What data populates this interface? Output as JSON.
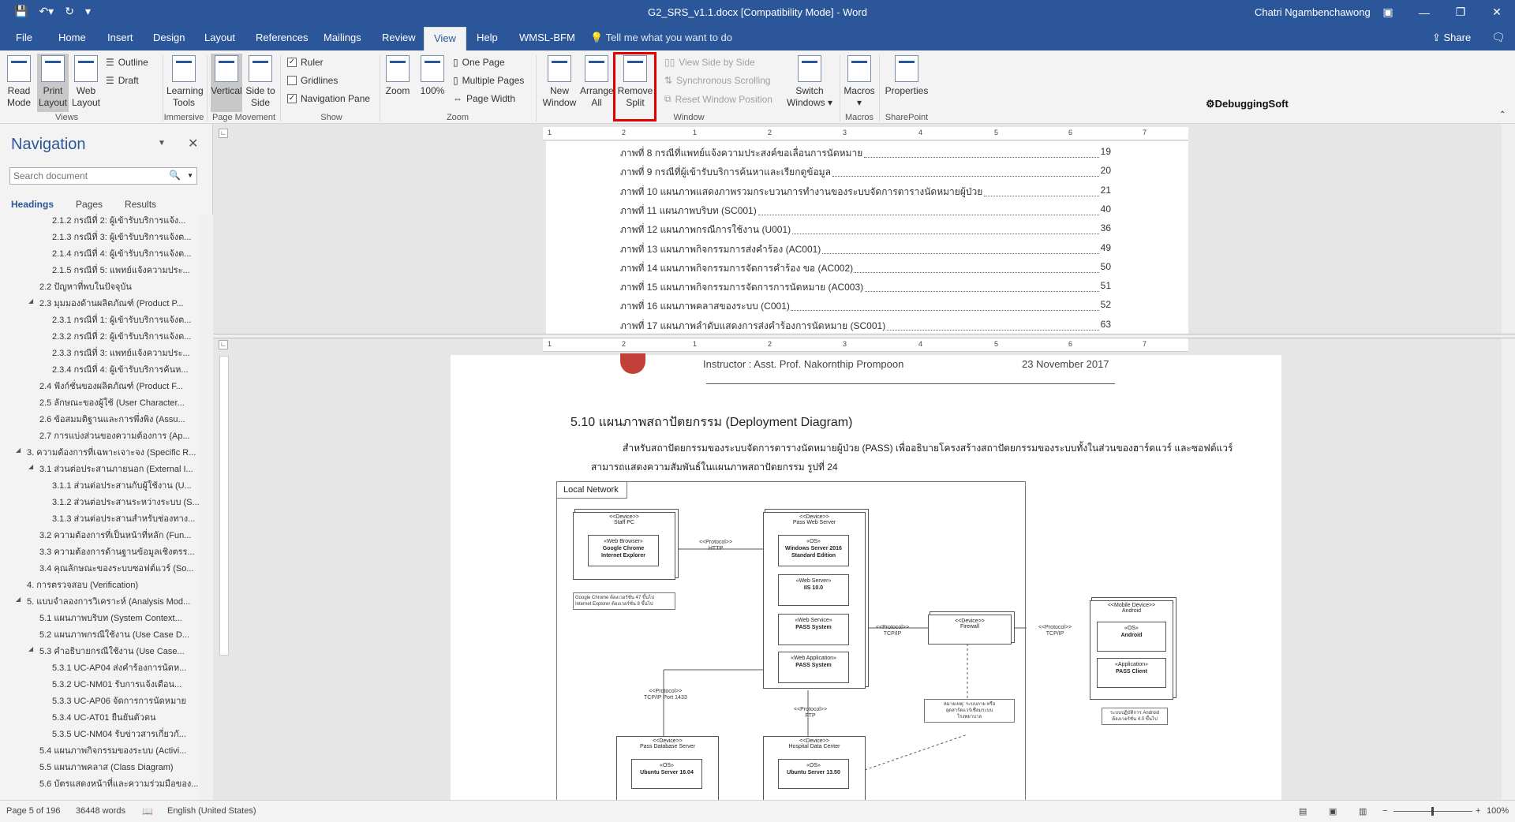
{
  "window": {
    "title": "G2_SRS_v1.1.docx [Compatibility Mode] - Word",
    "user": "Chatri Ngambenchawong"
  },
  "tabs": [
    "File",
    "Home",
    "Insert",
    "Design",
    "Layout",
    "References",
    "Mailings",
    "Review",
    "View",
    "Help",
    "WMSL-BFM"
  ],
  "active_tab": "View",
  "tell_me": "Tell me what you want to do",
  "share": "Share",
  "ribbon": {
    "views": {
      "read_mode": "Read Mode",
      "print_layout": "Print Layout",
      "web_layout": "Web Layout",
      "outline": "Outline",
      "draft": "Draft",
      "group": "Views"
    },
    "immersive": {
      "learning_tools": "Learning Tools",
      "group": "Immersive"
    },
    "page_movement": {
      "vertical": "Vertical",
      "side_to_side": "Side to Side",
      "group": "Page Movement"
    },
    "show": {
      "ruler": "Ruler",
      "gridlines": "Gridlines",
      "navigation_pane": "Navigation Pane",
      "group": "Show",
      "ruler_checked": true,
      "gridlines_checked": false,
      "navigation_checked": true
    },
    "zoom": {
      "zoom": "Zoom",
      "hundred": "100%",
      "one_page": "One Page",
      "multiple_pages": "Multiple Pages",
      "page_width": "Page Width",
      "group": "Zoom"
    },
    "window": {
      "new_window": "New Window",
      "arrange_all": "Arrange All",
      "remove_split": "Remove Split",
      "view_side_by_side": "View Side by Side",
      "synchronous_scrolling": "Synchronous Scrolling",
      "reset_window_position": "Reset Window Position",
      "switch_windows": "Switch Windows",
      "group": "Window"
    },
    "macros": {
      "macros": "Macros",
      "group": "Macros"
    },
    "sharepoint": {
      "properties": "Properties",
      "group": "SharePoint"
    }
  },
  "watermark_logo": "DebuggingSoft",
  "navigation": {
    "title": "Navigation",
    "search_placeholder": "Search document",
    "tabs": [
      "Headings",
      "Pages",
      "Results"
    ],
    "headings": [
      {
        "text": "2.1.2 กรณีที่ 2: ผู้เข้ารับบริการแจ้ง...",
        "level": 3
      },
      {
        "text": "2.1.3 กรณีที่ 3: ผู้เข้ารับบริการแจ้งต...",
        "level": 3
      },
      {
        "text": "2.1.4 กรณีที่ 4: ผู้เข้ารับบริการแจ้งต...",
        "level": 3
      },
      {
        "text": "2.1.5 กรณีที่ 5: แพทย์แจ้งความประ...",
        "level": 3
      },
      {
        "text": "2.2 ปัญหาที่พบในปัจจุบัน",
        "level": 2
      },
      {
        "text": "2.3 มุมมองด้านผลิตภัณฑ์ (Product P...",
        "level": 2,
        "expanded": true
      },
      {
        "text": "2.3.1 กรณีที่ 1: ผู้เข้ารับบริการแจ้งต...",
        "level": 3
      },
      {
        "text": "2.3.2 กรณีที่ 2: ผู้เข้ารับบริการแจ้งต...",
        "level": 3
      },
      {
        "text": "2.3.3 กรณีที่ 3: แพทย์แจ้งความประ...",
        "level": 3
      },
      {
        "text": "2.3.4 กรณีที่ 4: ผู้เข้ารับบริการค้นห...",
        "level": 3
      },
      {
        "text": "2.4 ฟังก์ชั่นของผลิตภัณฑ์ (Product F...",
        "level": 2
      },
      {
        "text": "2.5 ลักษณะของผู้ใช้ (User Character...",
        "level": 2
      },
      {
        "text": "2.6 ข้อสมมติฐานและการพึ่งพิง (Assu...",
        "level": 2
      },
      {
        "text": "2.7 การแบ่งส่วนของความต้องการ (Ap...",
        "level": 2
      },
      {
        "text": "3. ความต้องการที่เฉพาะเจาะจง (Specific R...",
        "level": 1,
        "expanded": true
      },
      {
        "text": "3.1 ส่วนต่อประสานภายนอก (External I...",
        "level": 2,
        "expanded": true
      },
      {
        "text": "3.1.1 ส่วนต่อประสานกับผู้ใช้งาน (U...",
        "level": 3
      },
      {
        "text": "3.1.2 ส่วนต่อประสานระหว่างระบบ (S...",
        "level": 3
      },
      {
        "text": "3.1.3 ส่วนต่อประสานสำหรับช่องทาง...",
        "level": 3
      },
      {
        "text": "3.2 ความต้องการที่เป็นหน้าที่หลัก (Fun...",
        "level": 2
      },
      {
        "text": "3.3 ความต้องการด้านฐานข้อมูลเชิงตรร...",
        "level": 2
      },
      {
        "text": "3.4 คุณลักษณะของระบบซอฟต์แวร์ (So...",
        "level": 2
      },
      {
        "text": "4. การตรวจสอบ (Verification)",
        "level": 1
      },
      {
        "text": "5. แบบจำลองการวิเคราะห์ (Analysis Mod...",
        "level": 1,
        "expanded": true
      },
      {
        "text": "5.1 แผนภาพบริบท (System Context...",
        "level": 2
      },
      {
        "text": "5.2 แผนภาพกรณีใช้งาน (Use Case D...",
        "level": 2
      },
      {
        "text": "5.3 คำอธิบายกรณีใช้งาน (Use Case...",
        "level": 2,
        "expanded": true
      },
      {
        "text": "5.3.1 UC-AP04 ส่งคำร้องการนัดห...",
        "level": 3
      },
      {
        "text": "5.3.2 UC-NM01 รับการแจ้งเตือน...",
        "level": 3
      },
      {
        "text": "5.3.3 UC-AP06 จัดการการนัดหมาย",
        "level": 3
      },
      {
        "text": "5.3.4 UC-AT01 ยืนยันตัวตน",
        "level": 3
      },
      {
        "text": "5.3.5 UC-NM04 รับข่าวสารเกี่ยวกั...",
        "level": 3
      },
      {
        "text": "5.4 แผนภาพกิจกรรมของระบบ (Activi...",
        "level": 2
      },
      {
        "text": "5.5 แผนภาพคลาส (Class Diagram)",
        "level": 2
      },
      {
        "text": "5.6 บัตรแสดงหน้าที่และความร่วมมือของ...",
        "level": 2
      }
    ]
  },
  "top_pane": {
    "ruler_numbers": [
      "1",
      "2",
      "1",
      "2",
      "3",
      "4",
      "5",
      "6",
      "7"
    ],
    "figures": [
      {
        "label": "ภาพที่ 8 กรณีที่แพทย์แจ้งความประสงค์ขอเลื่อนการนัดหมาย",
        "page": "19"
      },
      {
        "label": "ภาพที่ 9 กรณีที่ผู้เข้ารับบริการค้นหาและเรียกดูข้อมูล",
        "page": "20"
      },
      {
        "label": "ภาพที่ 10 แผนภาพแสดงภาพรวมกระบวนการทำงานของระบบจัดการตารางนัดหมายผู้ป่วย",
        "page": "21"
      },
      {
        "label": "ภาพที่ 11 แผนภาพบริบท (SC001)",
        "page": "40"
      },
      {
        "label": "ภาพที่ 12 แผนภาพกรณีการใช้งาน (U001)",
        "page": "36"
      },
      {
        "label": "ภาพที่ 13 แผนภาพกิจกรรมการส่งคำร้อง (AC001)",
        "page": "49"
      },
      {
        "label": "ภาพที่ 14 แผนภาพกิจกรรมการจัดการคำร้อง ขอ (AC002)",
        "page": "50"
      },
      {
        "label": "ภาพที่ 15 แผนภาพกิจกรรมการจัดการการนัดหมาย (AC003)",
        "page": "51"
      },
      {
        "label": "ภาพที่ 16 แผนภาพคลาสของระบบ (C001)",
        "page": "52"
      },
      {
        "label": "ภาพที่ 17 แผนภาพลำดับแสดงการส่งคำร้องการนัดหมาย (SC001)",
        "page": "63"
      }
    ]
  },
  "bottom_pane": {
    "header_instructor": "Instructor : Asst. Prof. Nakornthip Prompoon",
    "header_date": "23 November 2017",
    "section_title": "5.10  แผนภาพสถาปัตยกรรม (Deployment Diagram)",
    "paragraph_1": "สำหรับสถาปัตยกรรมของระบบจัดการตารางนัดหมายผู้ป่วย (PASS) เพื่ออธิบายโครงสร้างสถาปัตยกรรมของระบบทั้งในส่วนของฮาร์ดแวร์ และซอฟต์แวร์",
    "paragraph_2": "สามารถแสดงความสัมพันธ์ในแผนภาพสถาปัตยกรรม รูปที่ 24",
    "diagram": {
      "frame_label": "Local Network",
      "staff_pc": {
        "stereo": "<<Device>>",
        "name": "Staff PC",
        "inner_stereo": "«Web Browser»",
        "inner": "Google Chrome\nInternet Explorer"
      },
      "staff_note": "Google Chrome ต้องเวอร์ชั่น 47 ขึ้นไป\nInternet Explorer ต้องเวอร์ชั่น 8 ขึ้นไป",
      "http_conn": "<<Protocol>>\nHTTP",
      "web_server": {
        "stereo": "<<Device>>",
        "name": "Pass Web Server",
        "os_stereo": "«OS»",
        "os": "Windows Server 2016\nStandard Edition",
        "ws_stereo": "«Web Server»",
        "ws": "IIS 10.0",
        "svc_stereo": "«Web Service»",
        "svc": "PASS System",
        "app_stereo": "«Web Application»",
        "app": "PASS System"
      },
      "tcp_conn_1": "<<Protocol>>\nTCP/IP",
      "firewall": {
        "stereo": "<<Device>>",
        "name": "Firewall"
      },
      "tcp_conn_2": "<<Protocol>>\nTCP/IP",
      "mobile": {
        "stereo": "<<Mobile Device>>",
        "name": "Android",
        "os_stereo": "«OS»",
        "os": "Android",
        "app_stereo": "«Application»",
        "app": "PASS Client"
      },
      "mobile_note": "ระบบปฏิบัติการ Android\nต้องเวอร์ชั่น 4.0 ขึ้นไป",
      "firewall_note": "หมายเหตุ: ระบบภาย หรือ\nอุดสาร์ดแวร์เชื่อมระบบ\nโรงพยาบาล",
      "db_conn": "<<Protocol>>\nTCP/IP Port 1433",
      "ftp_conn": "<<Protocol>>\nFTP",
      "db_server": {
        "stereo": "<<Device>>",
        "name": "Pass Database Server",
        "os_stereo": "«OS»",
        "os": "Ubuntu Server 16.04"
      },
      "hospital": {
        "stereo": "<<Device>>",
        "name": "Hospital Data Center",
        "os_stereo": "«OS»",
        "os": "Ubuntu Server 13.50"
      }
    }
  },
  "status": {
    "page": "Page 5 of 196",
    "words": "36448 words",
    "language": "English (United States)",
    "zoom": "100%"
  }
}
